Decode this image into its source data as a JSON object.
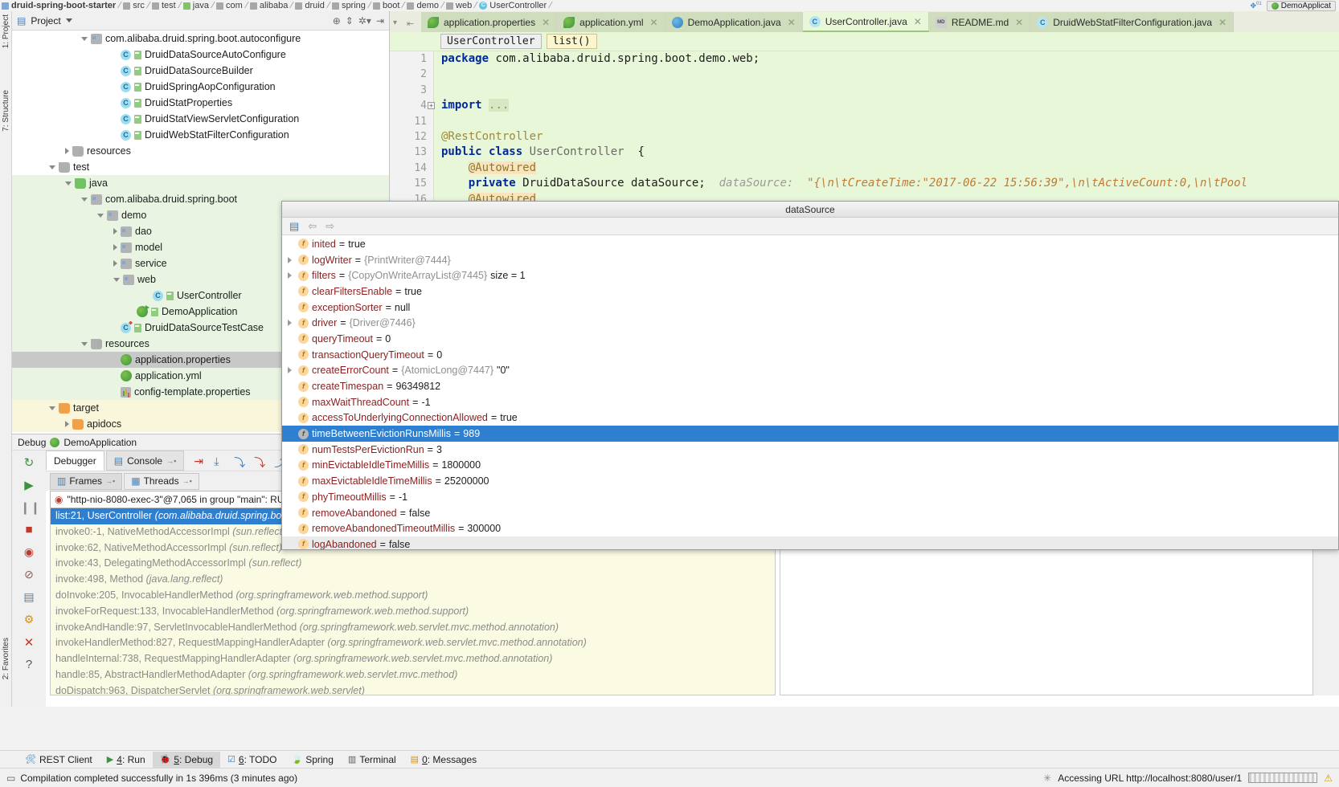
{
  "breadcrumb": {
    "items": [
      {
        "label": "druid-spring-boot-starter",
        "icon": "module-icon",
        "type": "module"
      },
      {
        "label": "src",
        "icon": "folder-icon",
        "type": "folder"
      },
      {
        "label": "test",
        "icon": "folder-icon",
        "type": "folder"
      },
      {
        "label": "java",
        "icon": "source-folder-icon",
        "type": "source"
      },
      {
        "label": "com",
        "icon": "folder-icon",
        "type": "folder"
      },
      {
        "label": "alibaba",
        "icon": "folder-icon",
        "type": "folder"
      },
      {
        "label": "druid",
        "icon": "folder-icon",
        "type": "folder"
      },
      {
        "label": "spring",
        "icon": "folder-icon",
        "type": "folder"
      },
      {
        "label": "boot",
        "icon": "folder-icon",
        "type": "folder"
      },
      {
        "label": "demo",
        "icon": "folder-icon",
        "type": "folder"
      },
      {
        "label": "web",
        "icon": "folder-icon",
        "type": "folder"
      },
      {
        "label": "UserController",
        "icon": "java-class-icon",
        "type": "class"
      }
    ],
    "run_config": "DemoApplicat"
  },
  "tabs": [
    {
      "label": "application.properties",
      "icon": "spring-leaf-icon",
      "active": false
    },
    {
      "label": "application.yml",
      "icon": "spring-leaf-icon",
      "active": false
    },
    {
      "label": "DemoApplication.java",
      "icon": "spring-boot-run-icon",
      "active": false
    },
    {
      "label": "UserController.java",
      "icon": "java-class-icon",
      "active": true
    },
    {
      "label": "README.md",
      "icon": "markdown-icon",
      "active": false
    },
    {
      "label": "DruidWebStatFilterConfiguration.java",
      "icon": "java-class-icon",
      "active": false
    }
  ],
  "project_panel": {
    "title": "Project",
    "tree": [
      {
        "depth": 4,
        "arrow": "down",
        "icon": "package-icon",
        "label": "com.alibaba.druid.spring.boot.autoconfigure",
        "bg": "white"
      },
      {
        "depth": 6,
        "arrow": "none",
        "icon": "java-class-icon",
        "label": "DruidDataSourceAutoConfigure",
        "bg": "white"
      },
      {
        "depth": 6,
        "arrow": "none",
        "icon": "java-class-icon",
        "label": "DruidDataSourceBuilder",
        "bg": "white"
      },
      {
        "depth": 6,
        "arrow": "none",
        "icon": "java-class-icon",
        "label": "DruidSpringAopConfiguration",
        "bg": "white"
      },
      {
        "depth": 6,
        "arrow": "none",
        "icon": "java-class-icon",
        "label": "DruidStatProperties",
        "bg": "white"
      },
      {
        "depth": 6,
        "arrow": "none",
        "icon": "java-class-icon",
        "label": "DruidStatViewServletConfiguration",
        "bg": "white"
      },
      {
        "depth": 6,
        "arrow": "none",
        "icon": "java-class-icon",
        "label": "DruidWebStatFilterConfiguration",
        "bg": "white"
      },
      {
        "depth": 3,
        "arrow": "right",
        "icon": "resources-folder-icon",
        "label": "resources",
        "bg": "white"
      },
      {
        "depth": 2,
        "arrow": "down",
        "icon": "folder-icon",
        "label": "test",
        "bg": "white"
      },
      {
        "depth": 3,
        "arrow": "down",
        "icon": "source-folder-icon",
        "label": "java",
        "bg": "green"
      },
      {
        "depth": 4,
        "arrow": "down",
        "icon": "package-icon",
        "label": "com.alibaba.druid.spring.boot",
        "bg": "green"
      },
      {
        "depth": 5,
        "arrow": "down",
        "icon": "package-icon",
        "label": "demo",
        "bg": "green"
      },
      {
        "depth": 6,
        "arrow": "right",
        "icon": "package-icon",
        "label": "dao",
        "bg": "green"
      },
      {
        "depth": 6,
        "arrow": "right",
        "icon": "package-icon",
        "label": "model",
        "bg": "green"
      },
      {
        "depth": 6,
        "arrow": "right",
        "icon": "package-icon",
        "label": "service",
        "bg": "green"
      },
      {
        "depth": 6,
        "arrow": "down",
        "icon": "package-icon",
        "label": "web",
        "bg": "green"
      },
      {
        "depth": 8,
        "arrow": "none",
        "icon": "java-class-icon",
        "label": "UserController",
        "bg": "green"
      },
      {
        "depth": 7,
        "arrow": "none",
        "icon": "spring-boot-run-icon",
        "label": "DemoApplication",
        "bg": "green"
      },
      {
        "depth": 6,
        "arrow": "none",
        "icon": "java-test-class-icon",
        "label": "DruidDataSourceTestCase",
        "bg": "green"
      },
      {
        "depth": 4,
        "arrow": "down",
        "icon": "resources-folder-icon",
        "label": "resources",
        "bg": "green"
      },
      {
        "depth": 6,
        "arrow": "none",
        "icon": "spring-leaf-icon",
        "label": "application.properties",
        "bg": "selected"
      },
      {
        "depth": 6,
        "arrow": "none",
        "icon": "spring-leaf-icon",
        "label": "application.yml",
        "bg": "green"
      },
      {
        "depth": 6,
        "arrow": "none",
        "icon": "properties-icon",
        "label": "config-template.properties",
        "bg": "green"
      },
      {
        "depth": 2,
        "arrow": "down",
        "icon": "target-folder-icon",
        "label": "target",
        "bg": "yellow"
      },
      {
        "depth": 3,
        "arrow": "right",
        "icon": "target-folder-icon",
        "label": "apidocs",
        "bg": "yellow"
      }
    ]
  },
  "editor": {
    "breadcrumb_class": "UserController",
    "breadcrumb_method": "list()",
    "lines": [
      {
        "num": "1",
        "tokens": [
          {
            "t": "package ",
            "c": "k"
          },
          {
            "t": "com.alibaba.druid.spring.boot.demo.web;",
            "c": "pl"
          }
        ]
      },
      {
        "num": "2",
        "tokens": []
      },
      {
        "num": "3",
        "tokens": []
      },
      {
        "num": "4",
        "tokens": [
          {
            "t": "import ",
            "c": "k"
          },
          {
            "t": "...",
            "c": "fold"
          }
        ],
        "folded": true
      },
      {
        "num": "11",
        "tokens": []
      },
      {
        "num": "12",
        "tokens": [
          {
            "t": "@RestController",
            "c": "ann"
          }
        ]
      },
      {
        "num": "13",
        "tokens": [
          {
            "t": "public class ",
            "c": "k"
          },
          {
            "t": "UserController",
            "c": "cls"
          },
          {
            "t": "  {",
            "c": "pl"
          }
        ]
      },
      {
        "num": "14",
        "tokens": [
          {
            "t": "    ",
            "c": "pl"
          },
          {
            "t": "@Autowired",
            "c": "annhi"
          }
        ]
      },
      {
        "num": "15",
        "tokens": [
          {
            "t": "    ",
            "c": "pl"
          },
          {
            "t": "private ",
            "c": "k"
          },
          {
            "t": "DruidDataSource dataSource;",
            "c": "pl"
          },
          {
            "t": "  dataSource:  ",
            "c": "hint"
          },
          {
            "t": "\"{\\n\\tCreateTime:\"2017-06-22 15:56:39\",\\n\\tActiveCount:0,\\n\\tPool",
            "c": "hintstr"
          }
        ]
      },
      {
        "num": "16",
        "tokens": [
          {
            "t": "    ",
            "c": "pl"
          },
          {
            "t": "@Autowired",
            "c": "annhi"
          }
        ]
      }
    ]
  },
  "datasource_popup": {
    "title": "dataSource",
    "toolbar_icons": [
      "file-structure-icon",
      "back-arrow-icon",
      "forward-arrow-icon"
    ],
    "fields": [
      {
        "expand": false,
        "name": "inited",
        "eq": "=",
        "value": "true",
        "ref": "",
        "sel": false
      },
      {
        "expand": true,
        "name": "logWriter",
        "eq": "=",
        "value": "",
        "ref": "{PrintWriter@7444}",
        "sel": false
      },
      {
        "expand": true,
        "name": "filters",
        "eq": "=",
        "value": "size = 1",
        "ref": "{CopyOnWriteArrayList@7445}",
        "sel": false
      },
      {
        "expand": false,
        "name": "clearFiltersEnable",
        "eq": "=",
        "value": "true",
        "ref": "",
        "sel": false
      },
      {
        "expand": false,
        "name": "exceptionSorter",
        "eq": "=",
        "value": "null",
        "ref": "",
        "sel": false
      },
      {
        "expand": true,
        "name": "driver",
        "eq": "=",
        "value": "",
        "ref": "{Driver@7446}",
        "sel": false
      },
      {
        "expand": false,
        "name": "queryTimeout",
        "eq": "=",
        "value": "0",
        "ref": "",
        "sel": false
      },
      {
        "expand": false,
        "name": "transactionQueryTimeout",
        "eq": "=",
        "value": "0",
        "ref": "",
        "sel": false
      },
      {
        "expand": true,
        "name": "createErrorCount",
        "eq": "=",
        "value": "\"0\"",
        "ref": "{AtomicLong@7447}",
        "sel": false
      },
      {
        "expand": false,
        "name": "createTimespan",
        "eq": "=",
        "value": "96349812",
        "ref": "",
        "sel": false
      },
      {
        "expand": false,
        "name": "maxWaitThreadCount",
        "eq": "=",
        "value": "-1",
        "ref": "",
        "sel": false
      },
      {
        "expand": false,
        "name": "accessToUnderlyingConnectionAllowed",
        "eq": "=",
        "value": "true",
        "ref": "",
        "sel": false
      },
      {
        "expand": false,
        "name": "timeBetweenEvictionRunsMillis",
        "eq": "=",
        "value": "989",
        "ref": "",
        "sel": true
      },
      {
        "expand": false,
        "name": "numTestsPerEvictionRun",
        "eq": "=",
        "value": "3",
        "ref": "",
        "sel": false
      },
      {
        "expand": false,
        "name": "minEvictableIdleTimeMillis",
        "eq": "=",
        "value": "1800000",
        "ref": "",
        "sel": false
      },
      {
        "expand": false,
        "name": "maxEvictableIdleTimeMillis",
        "eq": "=",
        "value": "25200000",
        "ref": "",
        "sel": false
      },
      {
        "expand": false,
        "name": "phyTimeoutMillis",
        "eq": "=",
        "value": "-1",
        "ref": "",
        "sel": false
      },
      {
        "expand": false,
        "name": "removeAbandoned",
        "eq": "=",
        "value": "false",
        "ref": "",
        "sel": false
      },
      {
        "expand": false,
        "name": "removeAbandonedTimeoutMillis",
        "eq": "=",
        "value": "300000",
        "ref": "",
        "sel": false
      },
      {
        "expand": false,
        "name": "logAbandoned",
        "eq": "=",
        "value": "false",
        "ref": "",
        "sel": false
      }
    ]
  },
  "debug_window": {
    "header_label": "Debug",
    "header_config": "DemoApplication",
    "tabs": [
      {
        "label": "Debugger",
        "active": true
      },
      {
        "label": "Console",
        "active": false
      }
    ],
    "sub_tabs": [
      {
        "label": "Frames",
        "active": true
      },
      {
        "label": "Threads",
        "active": false
      }
    ],
    "thread_selector": "\"http-nio-8080-exec-3\"@7,065 in group \"main\": RU",
    "frames": [
      {
        "method": "list:21, UserController",
        "package": "(com.alibaba.druid.spring.boot.",
        "selected": true
      },
      {
        "method": "invoke0:-1, NativeMethodAccessorImpl",
        "package": "(sun.reflect)",
        "selected": false
      },
      {
        "method": "invoke:62, NativeMethodAccessorImpl",
        "package": "(sun.reflect)",
        "selected": false
      },
      {
        "method": "invoke:43, DelegatingMethodAccessorImpl",
        "package": "(sun.reflect)",
        "selected": false
      },
      {
        "method": "invoke:498, Method",
        "package": "(java.lang.reflect)",
        "selected": false
      },
      {
        "method": "doInvoke:205, InvocableHandlerMethod",
        "package": "(org.springframework.web.method.support)",
        "selected": false
      },
      {
        "method": "invokeForRequest:133, InvocableHandlerMethod",
        "package": "(org.springframework.web.method.support)",
        "selected": false
      },
      {
        "method": "invokeAndHandle:97, ServletInvocableHandlerMethod",
        "package": "(org.springframework.web.servlet.mvc.method.annotation)",
        "selected": false
      },
      {
        "method": "invokeHandlerMethod:827, RequestMappingHandlerAdapter",
        "package": "(org.springframework.web.servlet.mvc.method.annotation)",
        "selected": false
      },
      {
        "method": "handleInternal:738, RequestMappingHandlerAdapter",
        "package": "(org.springframework.web.servlet.mvc.method.annotation)",
        "selected": false
      },
      {
        "method": "handle:85, AbstractHandlerMethodAdapter",
        "package": "(org.springframework.web.servlet.mvc.method)",
        "selected": false
      },
      {
        "method": "doDispatch:963, DispatcherServlet",
        "package": "(org.springframework.web.servlet)",
        "selected": false
      }
    ]
  },
  "bottom_bar": {
    "items": [
      {
        "label": "REST Client",
        "mnemonic": "",
        "icon": "rest-client-icon",
        "active": false
      },
      {
        "label": "Run",
        "mnemonic": "4",
        "icon": "run-icon",
        "active": false
      },
      {
        "label": "Debug",
        "mnemonic": "5",
        "icon": "debug-icon",
        "active": true
      },
      {
        "label": "TODO",
        "mnemonic": "6",
        "icon": "todo-icon",
        "active": false
      },
      {
        "label": "Spring",
        "mnemonic": "",
        "icon": "spring-leaf-icon",
        "active": false
      },
      {
        "label": "Terminal",
        "mnemonic": "",
        "icon": "terminal-icon",
        "active": false
      },
      {
        "label": "Messages",
        "mnemonic": "0",
        "icon": "messages-icon",
        "active": false
      }
    ]
  },
  "left_rail": {
    "labels": [
      "1: Project",
      "7: Structure",
      "2: Favorites"
    ]
  },
  "status_bar": {
    "message": "Compilation completed successfully in 1s 396ms (3 minutes ago)",
    "right_message": "Accessing URL http://localhost:8080/user/1"
  }
}
